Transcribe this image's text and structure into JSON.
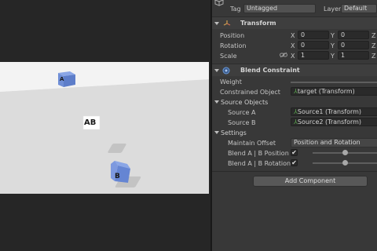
{
  "scene": {
    "cube_a_label": "A",
    "cube_ab_label": "AB",
    "cube_b_label": "B"
  },
  "inspector": {
    "tag_label": "Tag",
    "tag_value": "Untagged",
    "layer_label": "Layer",
    "layer_value": "Default",
    "transform": {
      "title": "Transform",
      "position_label": "Position",
      "rotation_label": "Rotation",
      "scale_label": "Scale",
      "x_label": "X",
      "y_label": "Y",
      "z_label": "Z",
      "position": {
        "x": "0",
        "y": "0"
      },
      "rotation": {
        "x": "0",
        "y": "0"
      },
      "scale": {
        "x": "1",
        "y": "1"
      }
    },
    "blend_constraint": {
      "title": "Blend Constraint",
      "weight_label": "Weight",
      "constrained_object_label": "Constrained Object",
      "constrained_object_value": "target (Transform)",
      "source_objects_header": "Source Objects",
      "source_a_label": "Source A",
      "source_a_value": "Source1 (Transform)",
      "source_b_label": "Source B",
      "source_b_value": "Source2 (Transform)",
      "settings_header": "Settings",
      "maintain_offset_label": "Maintain Offset",
      "maintain_offset_value": "Position and Rotation",
      "blend_position_label": "Blend A | B Position",
      "blend_position_checked": "✔",
      "blend_position_level": 0.5,
      "blend_rotation_label": "Blend A | B Rotation",
      "blend_rotation_checked": "✔",
      "blend_rotation_level": 0.5
    },
    "add_component_label": "Add Component"
  },
  "colors": {
    "cube_blue": "#6f8ed6",
    "object_icon_green": "#59a34f",
    "component_icon_blue": "#4f7fc1"
  }
}
